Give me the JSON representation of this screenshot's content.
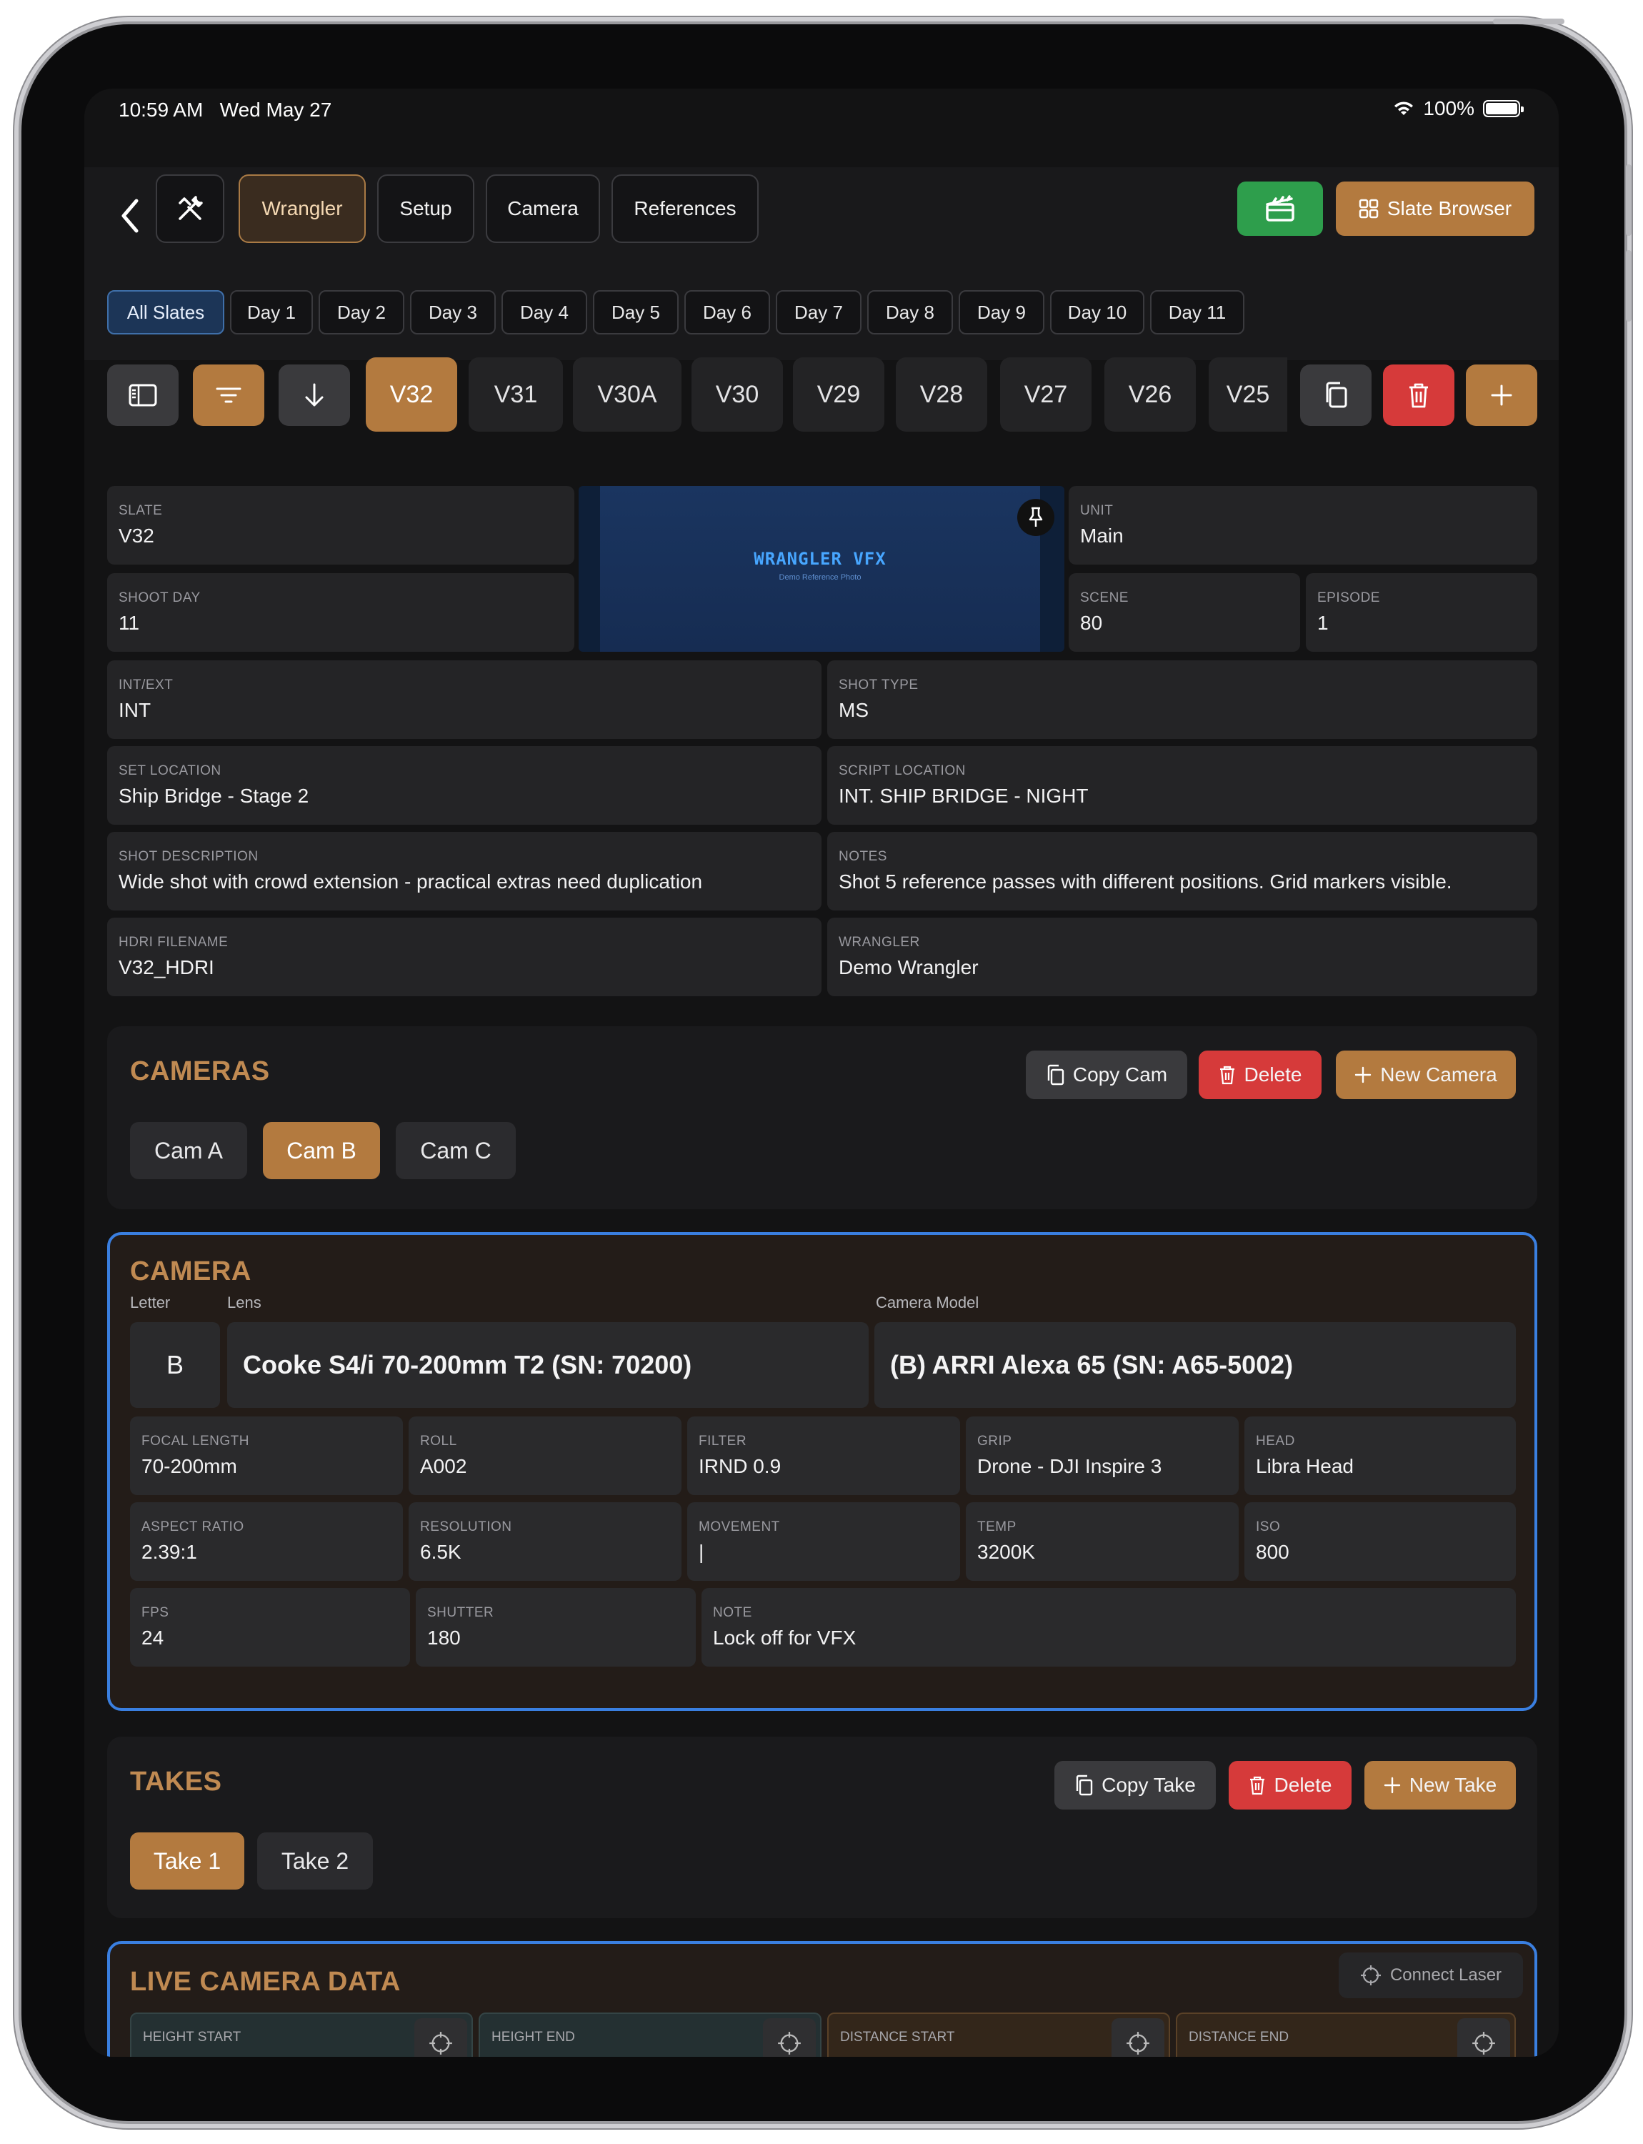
{
  "status": {
    "time": "10:59 AM",
    "date": "Wed May 27",
    "battery": "100%"
  },
  "nav": {
    "tabs": [
      "Wrangler",
      "Setup",
      "Camera",
      "References"
    ],
    "active_tab": "Wrangler",
    "slate_browser_label": "Slate Browser"
  },
  "days": [
    "All Slates",
    "Day 1",
    "Day 2",
    "Day 3",
    "Day 4",
    "Day 5",
    "Day 6",
    "Day 7",
    "Day 8",
    "Day 9",
    "Day 10",
    "Day 11"
  ],
  "slates": [
    "V32",
    "V31",
    "V30A",
    "V30",
    "V29",
    "V28",
    "V27",
    "V26",
    "V25"
  ],
  "active_slate": "V32",
  "photo": {
    "title": "WRANGLER VFX",
    "subtitle": "Demo Reference Photo"
  },
  "fields": {
    "slate": {
      "label": "SLATE",
      "value": "V32"
    },
    "shoot_day": {
      "label": "SHOOT DAY",
      "value": "11"
    },
    "unit": {
      "label": "UNIT",
      "value": "Main"
    },
    "scene": {
      "label": "SCENE",
      "value": "80"
    },
    "episode": {
      "label": "EPISODE",
      "value": "1"
    },
    "int_ext": {
      "label": "INT/EXT",
      "value": "INT"
    },
    "shot_type": {
      "label": "SHOT TYPE",
      "value": "MS"
    },
    "set_location": {
      "label": "SET LOCATION",
      "value": "Ship Bridge - Stage 2"
    },
    "script_location": {
      "label": "SCRIPT LOCATION",
      "value": "INT. SHIP BRIDGE - NIGHT"
    },
    "shot_description": {
      "label": "SHOT DESCRIPTION",
      "value": "Wide shot with crowd extension - practical extras need duplication"
    },
    "notes": {
      "label": "NOTES",
      "value": "Shot 5 reference passes with different positions. Grid markers visible."
    },
    "hdri": {
      "label": "HDRI FILENAME",
      "value": "V32_HDRI"
    },
    "wrangler": {
      "label": "WRANGLER",
      "value": "Demo Wrangler"
    }
  },
  "cameras": {
    "title": "CAMERAS",
    "copy_label": "Copy Cam",
    "delete_label": "Delete",
    "new_label": "New Camera",
    "items": [
      "Cam A",
      "Cam B",
      "Cam C"
    ],
    "active": "Cam B"
  },
  "camera": {
    "title": "CAMERA",
    "letter_label": "Letter",
    "lens_label": "Lens",
    "model_label": "Camera Model",
    "letter": "B",
    "lens": "Cooke S4/i 70-200mm T2 (SN: 70200)",
    "model": "(B) ARRI Alexa 65 (SN: A65-5002)",
    "focal_length": {
      "label": "FOCAL LENGTH",
      "value": "70-200mm"
    },
    "roll": {
      "label": "ROLL",
      "value": "A002"
    },
    "filter": {
      "label": "FILTER",
      "value": "IRND 0.9"
    },
    "grip": {
      "label": "GRIP",
      "value": "Drone - DJI Inspire 3"
    },
    "head": {
      "label": "HEAD",
      "value": "Libra Head"
    },
    "aspect": {
      "label": "ASPECT RATIO",
      "value": "2.39:1"
    },
    "resolution": {
      "label": "RESOLUTION",
      "value": "6.5K"
    },
    "movement": {
      "label": "MOVEMENT",
      "value": "|"
    },
    "temp": {
      "label": "TEMP",
      "value": "3200K"
    },
    "iso": {
      "label": "ISO",
      "value": "800"
    },
    "fps": {
      "label": "FPS",
      "value": "24"
    },
    "shutter": {
      "label": "SHUTTER",
      "value": "180"
    },
    "note": {
      "label": "NOTE",
      "value": "Lock off for VFX"
    }
  },
  "takes": {
    "title": "TAKES",
    "copy_label": "Copy Take",
    "delete_label": "Delete",
    "new_label": "New Take",
    "items": [
      "Take 1",
      "Take 2"
    ],
    "active": "Take 1"
  },
  "live": {
    "title": "LIVE CAMERA DATA",
    "connect_label": "Connect Laser",
    "fields": [
      "HEIGHT START",
      "HEIGHT END",
      "DISTANCE START",
      "DISTANCE END"
    ]
  },
  "colors": {
    "accent": "#b37a3f",
    "accent_text": "#c08a52",
    "danger": "#d63a3a",
    "success": "#2e9e4c",
    "focus": "#3a7fe0"
  }
}
